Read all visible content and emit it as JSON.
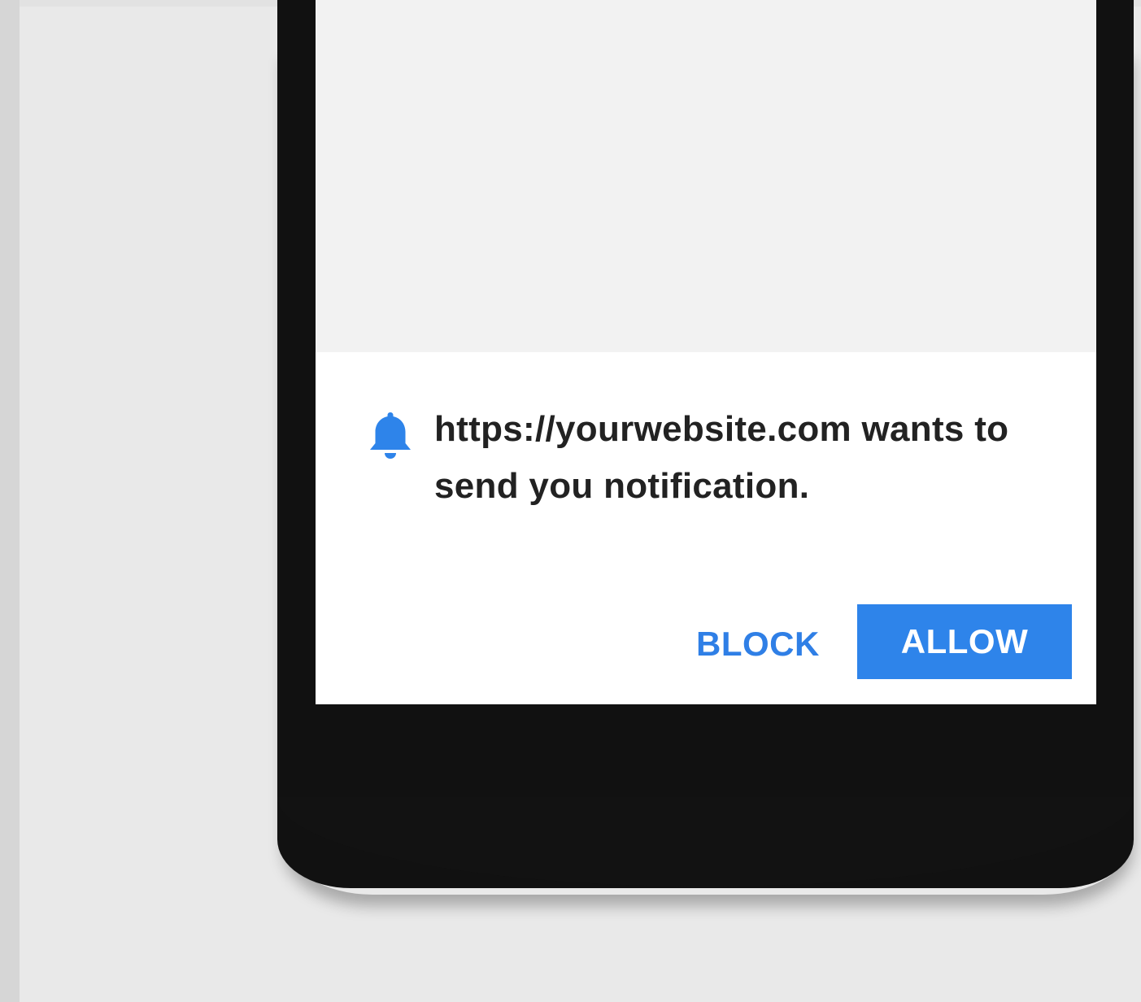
{
  "notification": {
    "icon": "bell-icon",
    "message": "https://yourwebsite.com wants to send you notification.",
    "block_label": "BLOCK",
    "allow_label": "ALLOW"
  },
  "colors": {
    "accent": "#2e84ea",
    "phone": "#111111",
    "background": "#e9e9e9"
  }
}
